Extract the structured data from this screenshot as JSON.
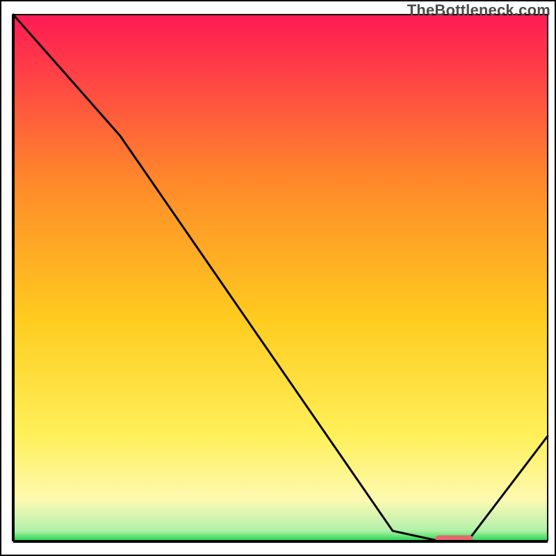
{
  "watermark": "TheBottleneck.com",
  "colors": {
    "gradient_top": "#ff1a55",
    "gradient_mid_orange": "#ff8a2a",
    "gradient_yellow": "#ffe52a",
    "gradient_pale_yellow": "#fff7a0",
    "gradient_pale_green": "#aef2a6",
    "gradient_green": "#1cd24a",
    "line": "#000000",
    "marker": "#e26a6a",
    "frame": "#000000"
  },
  "chart_data": {
    "type": "line",
    "title": "",
    "xlabel": "",
    "ylabel": "",
    "xlim": [
      0,
      100
    ],
    "ylim": [
      0,
      100
    ],
    "grid": false,
    "legend": "none",
    "x": [
      0,
      20,
      71,
      80,
      85,
      100
    ],
    "values": [
      100,
      77,
      2,
      0,
      0,
      20
    ],
    "marker": {
      "x_start": 79,
      "x_end": 86,
      "y": 0.5
    },
    "notes": "Curve starts at upper-left corner, slight slope break near x≈20, descends to a flat minimum around x≈80–85, then rises toward the right edge. Background is a vertical red→orange→yellow→green gradient with green concentrated in the bottom few percent."
  }
}
